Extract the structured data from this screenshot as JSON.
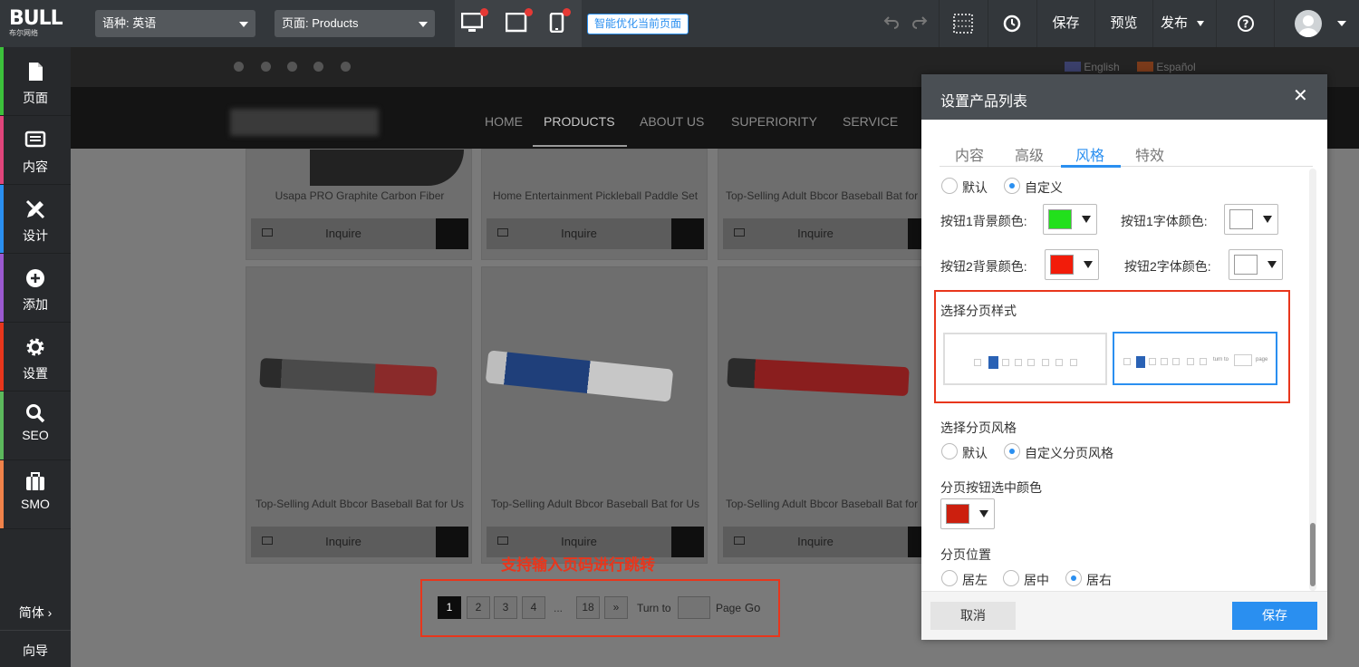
{
  "topbar": {
    "logo": "BULL",
    "logo_sub": "布尔网络",
    "language_select": "语种: 英语",
    "page_select": "页面: Products",
    "optimize_button": "智能优化当前页面",
    "save": "保存",
    "preview": "预览",
    "publish": "发布"
  },
  "sidebar": {
    "items": [
      {
        "label": "页面",
        "color": "#3cc13b"
      },
      {
        "label": "内容",
        "color": "#e0457b"
      },
      {
        "label": "设计",
        "color": "#2a8ff0"
      },
      {
        "label": "添加",
        "color": "#9b59d0"
      },
      {
        "label": "设置",
        "color": "#e8361c"
      },
      {
        "label": "SEO",
        "color": "#5cb85c"
      },
      {
        "label": "SMO",
        "color": "#f0824a"
      }
    ],
    "simplified": "简体",
    "guide": "向导"
  },
  "site": {
    "languages": [
      "English",
      "Español"
    ],
    "nav": [
      "HOME",
      "PRODUCTS",
      "ABOUT US",
      "SUPERIORITY",
      "SERVICE"
    ],
    "products_row1": [
      "Usapa PRO Graphite Carbon Fiber",
      "Home Entertainment Pickleball Paddle Set",
      "Top-Selling Adult Bbcor Baseball Bat for Us"
    ],
    "products_row2": [
      "Top-Selling Adult Bbcor Baseball Bat for Us",
      "Top-Selling Adult Bbcor Baseball Bat for Us",
      "Top-Selling Adult Bbcor Baseball Bat for Us"
    ],
    "inquire": "Inquire",
    "annotation": "支持输入页码进行跳转",
    "pagination": {
      "pages": [
        "1",
        "2",
        "3",
        "4"
      ],
      "ellipsis": "...",
      "last": "18",
      "next": "»",
      "turn_to": "Turn to",
      "page": "Page",
      "go": "Go"
    }
  },
  "dialog": {
    "title": "设置产品列表",
    "tabs": [
      "内容",
      "高级",
      "风格",
      "特效"
    ],
    "active_tab": "风格",
    "style_default": "默认",
    "style_custom": "自定义",
    "btn1_bg": "按钮1背景颜色:",
    "btn1_font": "按钮1字体颜色:",
    "btn2_bg": "按钮2背景颜色:",
    "btn2_font": "按钮2字体颜色:",
    "colors": {
      "btn1_bg": "#22e01c",
      "btn1_font": "#ffffff",
      "btn2_bg": "#f21c0a",
      "btn2_font": "#ffffff",
      "selected": "#cc1f0e",
      "accent": "#2a8ff0"
    },
    "page_style_label": "选择分页样式",
    "preview_turn_to": "turn to",
    "preview_page": "page",
    "pagination_style_label": "选择分页风格",
    "pstyle_default": "默认",
    "pstyle_custom": "自定义分页风格",
    "selected_color_label": "分页按钮选中颜色",
    "position_label": "分页位置",
    "pos_left": "居左",
    "pos_center": "居中",
    "pos_right": "居右",
    "cancel": "取消",
    "save": "保存"
  }
}
